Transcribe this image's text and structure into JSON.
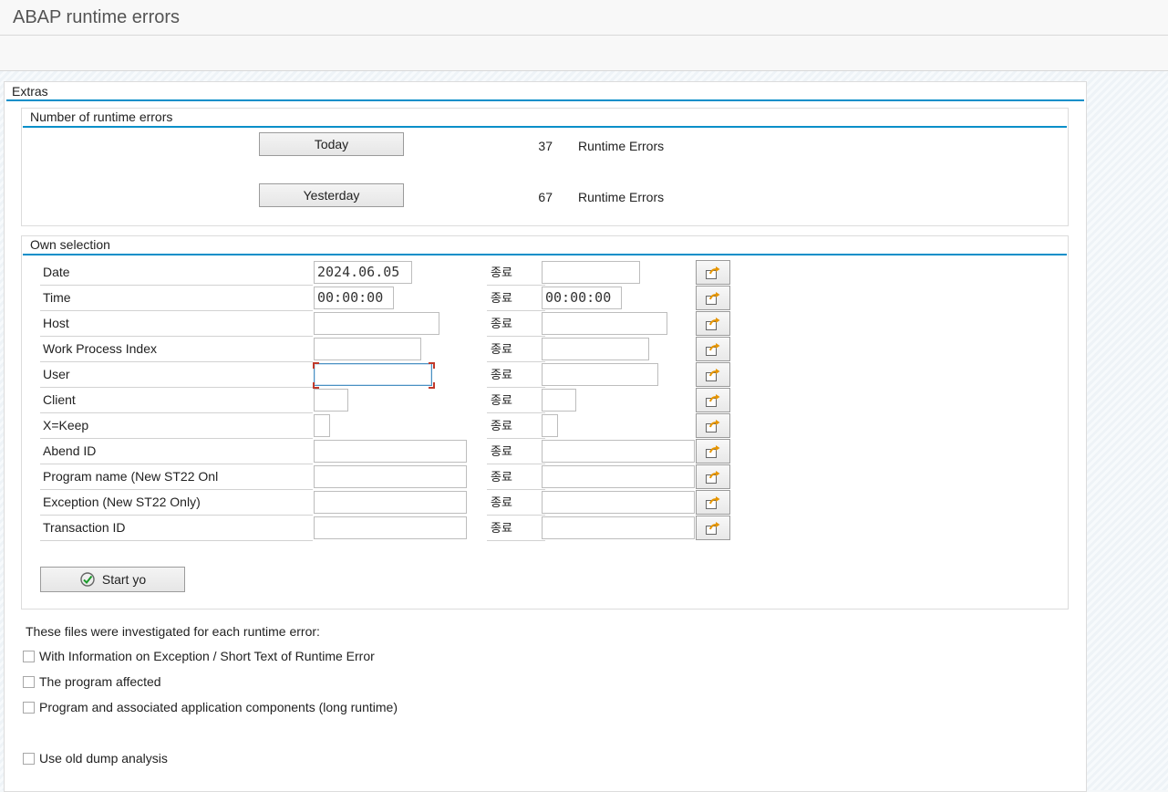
{
  "window": {
    "title": "ABAP runtime errors"
  },
  "extras": {
    "title": "Extras"
  },
  "runtime_errors": {
    "title": "Number of runtime errors",
    "today": {
      "button_label": "Today",
      "count": "37",
      "count_label": "Runtime Errors"
    },
    "yesterday": {
      "button_label": "Yesterday",
      "count": "67",
      "count_label": "Runtime Errors"
    }
  },
  "own_selection": {
    "title": "Own selection",
    "to_label": "종료",
    "rows": [
      {
        "label": "Date",
        "from": "2024.06.05",
        "to": ""
      },
      {
        "label": "Time",
        "from": "00:00:00",
        "to": "00:00:00"
      },
      {
        "label": "Host",
        "from": "",
        "to": ""
      },
      {
        "label": "Work Process Index",
        "from": "",
        "to": ""
      },
      {
        "label": "User",
        "from": "",
        "to": ""
      },
      {
        "label": "Client",
        "from": "",
        "to": ""
      },
      {
        "label": "X=Keep",
        "from": "",
        "to": ""
      },
      {
        "label": "Abend ID",
        "from": "",
        "to": ""
      },
      {
        "label": "Program name (New ST22 Onl",
        "from": "",
        "to": ""
      },
      {
        "label": "Exception (New ST22 Only)",
        "from": "",
        "to": ""
      },
      {
        "label": "Transaction ID",
        "from": "",
        "to": ""
      }
    ],
    "start_button": "Start yo"
  },
  "investigation": {
    "heading": "These files were investigated for each runtime error:",
    "options": [
      {
        "label": "With Information on Exception / Short Text of Runtime Error",
        "checked": false
      },
      {
        "label": "The program affected",
        "checked": false
      },
      {
        "label": "Program and associated application components (long runtime)",
        "checked": false
      }
    ],
    "old_dump": {
      "label": "Use old dump analysis",
      "checked": false
    }
  },
  "colors": {
    "accent": "#0a8fc9",
    "icon_orange": "#e69500"
  }
}
